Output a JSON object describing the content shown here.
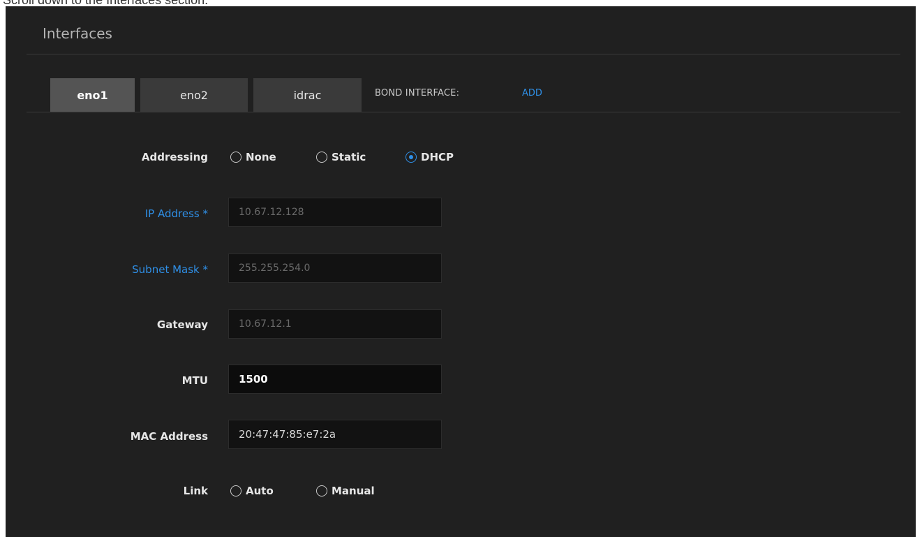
{
  "caption": "Scroll down to the Interfaces section.",
  "section_title": "Interfaces",
  "tabs": [
    {
      "label": "eno1",
      "active": true
    },
    {
      "label": "eno2",
      "active": false
    },
    {
      "label": "idrac",
      "active": false
    }
  ],
  "bond": {
    "label": "BOND INTERFACE:",
    "action": "ADD"
  },
  "addressing": {
    "label": "Addressing",
    "options": [
      "None",
      "Static",
      "DHCP"
    ],
    "selected": "DHCP"
  },
  "fields": {
    "ip_address": {
      "label": "IP Address *",
      "value": "10.67.12.128"
    },
    "subnet_mask": {
      "label": "Subnet Mask *",
      "value": "255.255.254.0"
    },
    "gateway": {
      "label": "Gateway",
      "value": "10.67.12.1"
    },
    "mtu": {
      "label": "MTU",
      "value": "1500"
    },
    "mac_address": {
      "label": "MAC Address",
      "value": "20:47:47:85:e7:2a"
    }
  },
  "link": {
    "label": "Link",
    "options": [
      "Auto",
      "Manual"
    ],
    "selected": ""
  },
  "colors": {
    "panel_bg": "#202020",
    "accent": "#2f8fe6",
    "tab_active": "#545454",
    "tab_inactive": "#3a3a3a"
  }
}
